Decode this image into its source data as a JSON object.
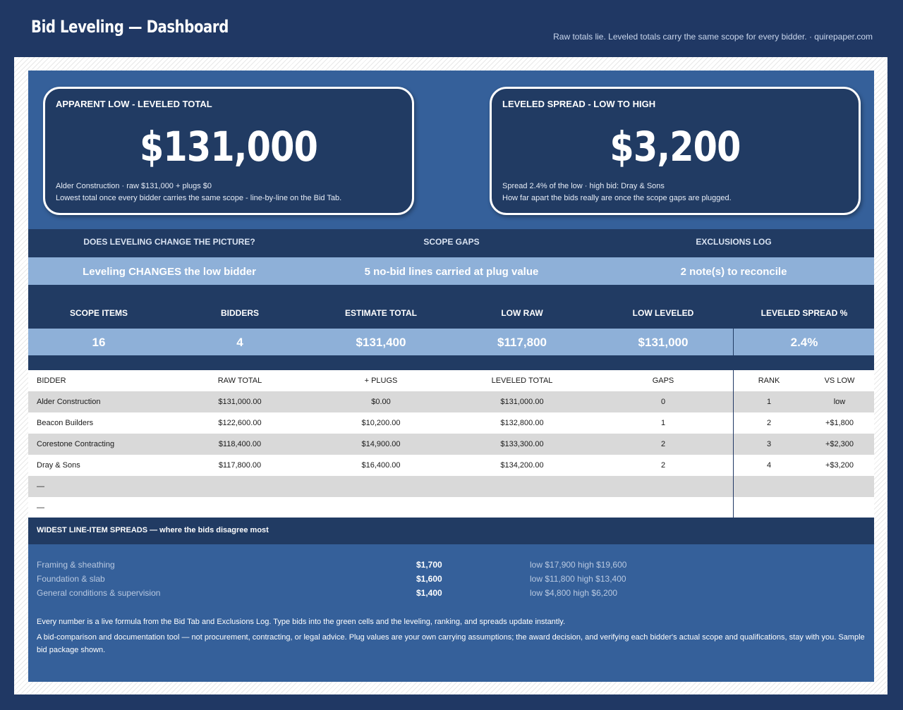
{
  "header": {
    "title": "Bid Leveling — Dashboard",
    "subtitle": "Raw totals lie. Leveled totals carry the same scope for every bidder.  ·  quirepaper.com"
  },
  "kpi_left": {
    "label": "APPARENT LOW - LEVELED TOTAL",
    "value": "$131,000",
    "line1": "Alder Construction  ·  raw $131,000 + plugs $0",
    "line2": "Lowest total once every bidder carries the same scope - line-by-line on the Bid Tab."
  },
  "kpi_right": {
    "label": "LEVELED SPREAD - LOW TO HIGH",
    "value": "$3,200",
    "line1": "Spread 2.4% of the low  ·  high bid: Dray & Sons",
    "line2": "How far apart the bids really are once the scope gaps are plugged."
  },
  "status": {
    "headers": [
      "DOES LEVELING CHANGE THE PICTURE?",
      "SCOPE GAPS",
      "EXCLUSIONS LOG"
    ],
    "values": [
      "Leveling CHANGES the low bidder",
      "5 no-bid lines carried at plug value",
      "2 note(s) to reconcile"
    ]
  },
  "stats": {
    "headers": [
      "SCOPE ITEMS",
      "BIDDERS",
      "ESTIMATE TOTAL",
      "LOW RAW",
      "LOW LEVELED",
      "LEVELED SPREAD %"
    ],
    "values": [
      "16",
      "4",
      "$131,400",
      "$117,800",
      "$131,000",
      "2.4%"
    ]
  },
  "table": {
    "columns": [
      "BIDDER",
      "RAW TOTAL",
      "+ PLUGS",
      "LEVELED TOTAL",
      "GAPS",
      "RANK",
      "VS LOW"
    ],
    "rows": [
      [
        "Alder Construction",
        "$131,000.00",
        "$0.00",
        "$131,000.00",
        "0",
        "1",
        "low"
      ],
      [
        "Beacon Builders",
        "$122,600.00",
        "$10,200.00",
        "$132,800.00",
        "1",
        "2",
        "+$1,800"
      ],
      [
        "Corestone Contracting",
        "$118,400.00",
        "$14,900.00",
        "$133,300.00",
        "2",
        "3",
        "+$2,300"
      ],
      [
        "Dray & Sons",
        "$117,800.00",
        "$16,400.00",
        "$134,200.00",
        "2",
        "4",
        "+$3,200"
      ],
      [
        "—",
        "",
        "",
        "",
        "",
        "",
        ""
      ],
      [
        "—",
        "",
        "",
        "",
        "",
        "",
        ""
      ]
    ]
  },
  "spreads": {
    "title": "WIDEST LINE-ITEM SPREADS — where the bids disagree most",
    "items": [
      {
        "name": "Framing & sheathing",
        "amount": "$1,700",
        "range": "low $17,900  high $19,600"
      },
      {
        "name": "Foundation & slab",
        "amount": "$1,600",
        "range": "low $11,800  high $13,400"
      },
      {
        "name": "General conditions & supervision",
        "amount": "$1,400",
        "range": "low $4,800  high $6,200"
      }
    ]
  },
  "footer": {
    "note1": "Every number is a live formula from the Bid Tab and Exclusions Log. Type bids into the green cells and the leveling, ranking, and spreads update instantly.",
    "note2": "A bid-comparison and documentation tool — not procurement, contracting, or legal advice. Plug values are your own carrying assumptions; the award decision, and verifying each bidder's actual scope and qualifications, stay with you. Sample bid package shown."
  },
  "colors": {
    "background": "#203864",
    "panel": "#35609a",
    "dark_band": "#213b63",
    "light_band": "#8eb0d8",
    "row_shade": "#d9d9d9"
  }
}
